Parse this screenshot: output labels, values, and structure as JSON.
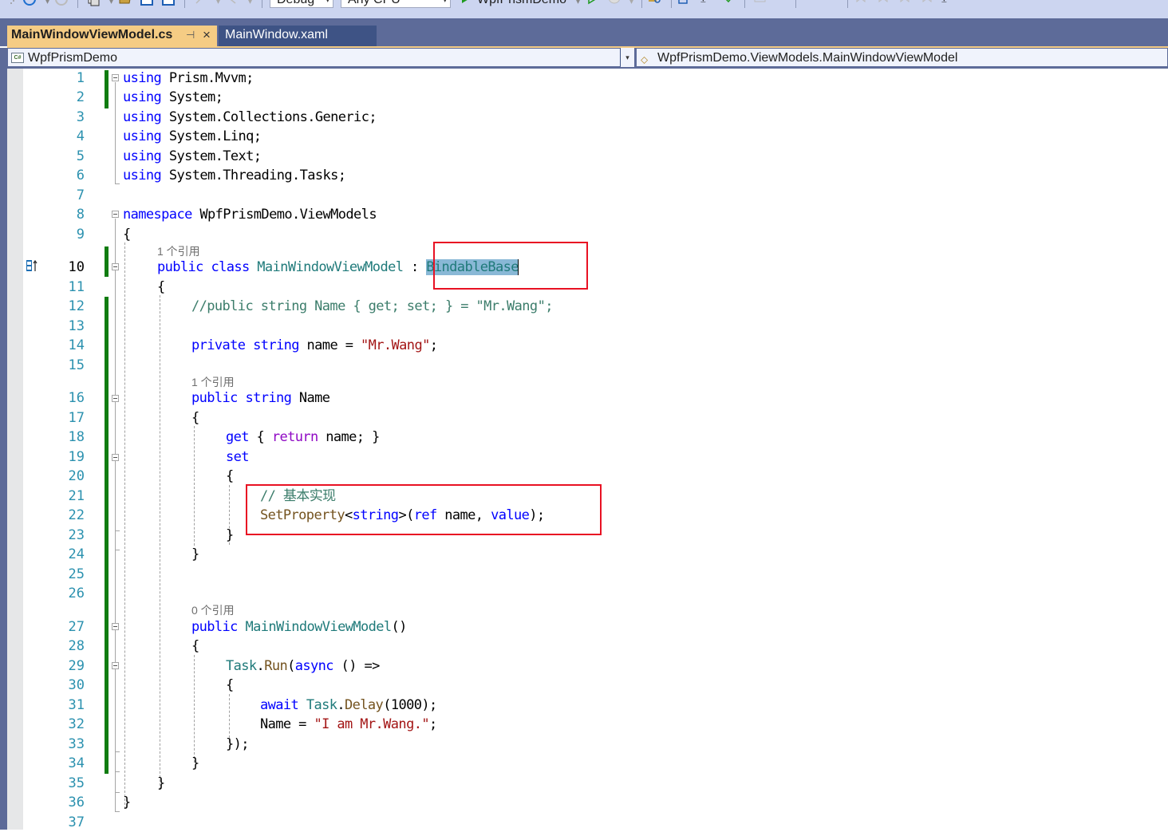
{
  "toolbar": {
    "configuration": "Debug",
    "platform": "Any CPU",
    "start_project": "WpfPrismDemo",
    "icons": [
      "back-icon",
      "forward-icon",
      "new-project-icon",
      "open-folder-icon",
      "save-icon",
      "save-all-icon",
      "undo-icon",
      "redo-icon",
      "start-icon",
      "start-without-debugging-icon",
      "stop-icon",
      "find-icon",
      "home-icon",
      "overflow-icon",
      "check-icon",
      "comment-icon",
      "uncomment-icon",
      "indent-icon",
      "outdent-icon",
      "bookmark-icon",
      "bookmark-prev-icon",
      "bookmark-next-icon",
      "bookmark-clear-icon",
      "toolbar-options-icon"
    ]
  },
  "tabs": [
    {
      "label": "MainWindowViewModel.cs",
      "active": true,
      "pinned_icon": "⊣",
      "close_icon": "×"
    },
    {
      "label": "MainWindow.xaml",
      "active": false
    }
  ],
  "navigation": {
    "project": "WpfPrismDemo",
    "project_icon": "C#",
    "type": "WpfPrismDemo.ViewModels.MainWindowViewModel"
  },
  "editor": {
    "current_line": 10,
    "codelens": {
      "class": "1 个引用",
      "property": "1 个引用",
      "constructor": "0 个引用"
    },
    "lines": [
      {
        "n": "1"
      },
      {
        "n": "2"
      },
      {
        "n": "3"
      },
      {
        "n": "4"
      },
      {
        "n": "5"
      },
      {
        "n": "6"
      },
      {
        "n": "7"
      },
      {
        "n": "8"
      },
      {
        "n": "9"
      },
      {
        "n": "10"
      },
      {
        "n": "11"
      },
      {
        "n": "12"
      },
      {
        "n": "13"
      },
      {
        "n": "14"
      },
      {
        "n": "15"
      },
      {
        "n": "16"
      },
      {
        "n": "17"
      },
      {
        "n": "18"
      },
      {
        "n": "19"
      },
      {
        "n": "20"
      },
      {
        "n": "21"
      },
      {
        "n": "22"
      },
      {
        "n": "23"
      },
      {
        "n": "24"
      },
      {
        "n": "25"
      },
      {
        "n": "26"
      },
      {
        "n": "27"
      },
      {
        "n": "28"
      },
      {
        "n": "29"
      },
      {
        "n": "30"
      },
      {
        "n": "31"
      },
      {
        "n": "32"
      },
      {
        "n": "33"
      },
      {
        "n": "34"
      },
      {
        "n": "35"
      },
      {
        "n": "36"
      },
      {
        "n": "37"
      }
    ],
    "code": {
      "l1": [
        "using",
        " Prism.Mvvm;"
      ],
      "l2": [
        "using",
        " System;"
      ],
      "l3": [
        "using",
        " System.Collections.Generic;"
      ],
      "l4": [
        "using",
        " System.Linq;"
      ],
      "l5": [
        "using",
        " System.Text;"
      ],
      "l6": [
        "using",
        " System.Threading.Tasks;"
      ],
      "l8": [
        "namespace",
        " WpfPrismDemo.ViewModels"
      ],
      "l9": "{",
      "l10": [
        "public",
        " ",
        "class",
        " ",
        "MainWindowViewModel",
        " : ",
        "BindableBase"
      ],
      "l11": "{",
      "l12": "//public string Name { get; set; } = \"Mr.Wang\";",
      "l14": [
        "private",
        " ",
        "string",
        " name = ",
        "\"Mr.Wang\"",
        ";"
      ],
      "l16": [
        "public",
        " ",
        "string",
        " Name"
      ],
      "l17": "{",
      "l18": [
        "get",
        " { ",
        "return",
        " name; }"
      ],
      "l19": "set",
      "l20": "{",
      "l21": "// 基本实现",
      "l22": [
        "SetProperty",
        "<",
        "string",
        ">(",
        "ref",
        " name, ",
        "value",
        ");"
      ],
      "l23": "}",
      "l24": "}",
      "l27": [
        "public",
        " ",
        "MainWindowViewModel",
        "()"
      ],
      "l28": "{",
      "l29": [
        "Task",
        ".",
        "Run",
        "(",
        "async",
        " () =>"
      ],
      "l30": "{",
      "l31": [
        "await",
        " ",
        "Task",
        ".",
        "Delay",
        "(1000);"
      ],
      "l32": [
        "Name = ",
        "\"I am Mr.Wang.\"",
        ";"
      ],
      "l33": "});",
      "l34": "}",
      "l35": "}",
      "l36": "}"
    }
  },
  "annotations": {
    "highlight_color": "#e81123",
    "boxes": [
      "base-class-annotation",
      "set-property-annotation"
    ]
  }
}
